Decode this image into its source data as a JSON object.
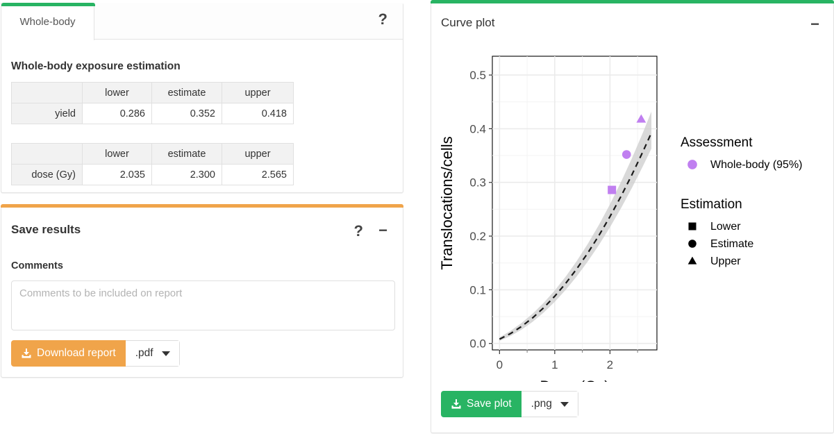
{
  "results_panel": {
    "accent_color": "#28b463",
    "tabs": [
      {
        "label": "Whole-body",
        "active": true
      }
    ],
    "help_icon": "?",
    "section_title": "Whole-body exposure estimation",
    "yield_table": {
      "columns": [
        "",
        "lower",
        "estimate",
        "upper"
      ],
      "rows": [
        {
          "label": "yield",
          "lower": "0.286",
          "estimate": "0.352",
          "upper": "0.418"
        }
      ]
    },
    "dose_table": {
      "columns": [
        "",
        "lower",
        "estimate",
        "upper"
      ],
      "rows": [
        {
          "label": "dose (Gy)",
          "lower": "2.035",
          "estimate": "2.300",
          "upper": "2.565"
        }
      ]
    }
  },
  "save_panel": {
    "accent_color": "#f0a44a",
    "title": "Save results",
    "help_icon": "?",
    "minimize_icon": "−",
    "comments_label": "Comments",
    "comments_value": "",
    "comments_placeholder": "Comments to be included on report",
    "download_button_label": "Download report",
    "download_button_color": "#f0a44a",
    "format_value": ".pdf"
  },
  "plot_panel": {
    "accent_color": "#28b463",
    "title": "Curve plot",
    "minimize_icon": "−",
    "save_button_label": "Save plot",
    "save_button_color": "#28b463",
    "format_value": ".png"
  },
  "chart_data": {
    "type": "line",
    "title": "",
    "xlabel": "Dose (Gy)",
    "ylabel": "Translocations/cells",
    "xlim": [
      -0.13,
      2.85
    ],
    "ylim": [
      -0.012,
      0.535
    ],
    "xticks": [
      0,
      1,
      2
    ],
    "xticklabels": [
      "0",
      "1",
      "2"
    ],
    "xminorticks": [
      0.5,
      1.5,
      2.5
    ],
    "yticks": [
      0.0,
      0.1,
      0.2,
      0.3,
      0.4,
      0.5
    ],
    "yticklabels": [
      "0.0",
      "0.1",
      "0.2",
      "0.3",
      "0.4",
      "0.5"
    ],
    "yminorticks": [
      0.05,
      0.15,
      0.25,
      0.35,
      0.45
    ],
    "grid": true,
    "series": [
      {
        "name": "fitted dose-effect curve",
        "type": "line",
        "linestyle": "dashed",
        "color": "#1a1a1a",
        "x": [
          0.0,
          0.2,
          0.4,
          0.6,
          0.8,
          1.0,
          1.2,
          1.4,
          1.6,
          1.8,
          2.0,
          2.2,
          2.4,
          2.6,
          2.75
        ],
        "y": [
          0.008,
          0.0185,
          0.0318,
          0.0478,
          0.0665,
          0.088,
          0.1122,
          0.1392,
          0.1688,
          0.2012,
          0.2364,
          0.2742,
          0.3148,
          0.3582,
          0.3924
        ]
      },
      {
        "name": "confidence band (upper)",
        "type": "band",
        "color": "#cccccc",
        "x": [
          0.0,
          0.2,
          0.4,
          0.6,
          0.8,
          1.0,
          1.2,
          1.4,
          1.6,
          1.8,
          2.0,
          2.2,
          2.4,
          2.6,
          2.75
        ],
        "y_upper": [
          0.0115,
          0.0235,
          0.0382,
          0.0556,
          0.0757,
          0.0988,
          0.1248,
          0.1538,
          0.1858,
          0.221,
          0.2592,
          0.3008,
          0.3456,
          0.3938,
          0.432
        ],
        "y_lower": [
          0.0046,
          0.0138,
          0.0258,
          0.0404,
          0.0576,
          0.0775,
          0.1,
          0.1252,
          0.153,
          0.1834,
          0.2164,
          0.252,
          0.2902,
          0.331,
          0.363
        ]
      }
    ],
    "points": [
      {
        "label": "Lower",
        "marker": "square",
        "x": 2.035,
        "y": 0.286,
        "color": "#c07ff0"
      },
      {
        "label": "Estimate",
        "marker": "circle",
        "x": 2.3,
        "y": 0.352,
        "color": "#c07ff0"
      },
      {
        "label": "Upper",
        "marker": "triangle",
        "x": 2.565,
        "y": 0.418,
        "color": "#c07ff0"
      }
    ],
    "legends": [
      {
        "title": "Assessment",
        "entries": [
          {
            "label": "Whole-body (95%)",
            "marker": "circle",
            "color": "#c07ff0"
          }
        ]
      },
      {
        "title": "Estimation",
        "entries": [
          {
            "label": "Lower",
            "marker": "square",
            "color": "#000000"
          },
          {
            "label": "Estimate",
            "marker": "circle",
            "color": "#000000"
          },
          {
            "label": "Upper",
            "marker": "triangle",
            "color": "#000000"
          }
        ]
      }
    ]
  }
}
